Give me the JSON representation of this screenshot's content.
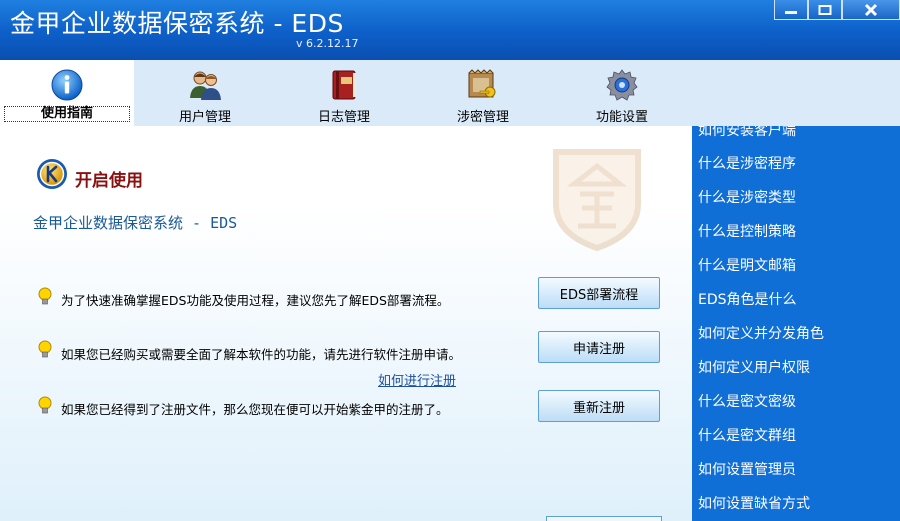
{
  "window": {
    "title": "金甲企业数据保密系统 - EDS",
    "version": "v 6.2.12.17"
  },
  "toolbar": {
    "items": [
      {
        "label": "使用指南",
        "icon": "info-icon"
      },
      {
        "label": "用户管理",
        "icon": "users-icon"
      },
      {
        "label": "日志管理",
        "icon": "logbook-icon"
      },
      {
        "label": "涉密管理",
        "icon": "secret-key-icon"
      },
      {
        "label": "功能设置",
        "icon": "gear-icon"
      }
    ]
  },
  "main": {
    "section_title": "开启使用",
    "subtitle": "金甲企业数据保密系统 - EDS",
    "rows": [
      {
        "text": "为了快速准确掌握EDS功能及使用过程，建议您先了解EDS部署流程。",
        "button": "EDS部署流程"
      },
      {
        "text": "如果您已经购买或需要全面了解本软件的功能，请先进行软件注册申请。",
        "button": "申请注册"
      },
      {
        "text": "如果您已经得到了注册文件，那么您现在便可以开始紫金甲的注册了。",
        "button": "重新注册"
      }
    ],
    "register_link": "如何进行注册"
  },
  "sidebar": {
    "items": [
      "如何安装客户端",
      "什么是涉密程序",
      "什么是涉密类型",
      "什么是控制策略",
      "什么是明文邮箱",
      "EDS角色是什么",
      "如何定义并分发角色",
      "如何定义用户权限",
      "什么是密文密级",
      "什么是密文群组",
      "如何设置管理员",
      "如何设置缺省方式"
    ]
  },
  "colors": {
    "titlebar": "#0d5fc8",
    "toolbar": "#dbeaf8",
    "sidebar": "#0f6fd6",
    "section_title": "#8a1010",
    "subtitle": "#1a5a96",
    "link": "#1f50a0"
  }
}
